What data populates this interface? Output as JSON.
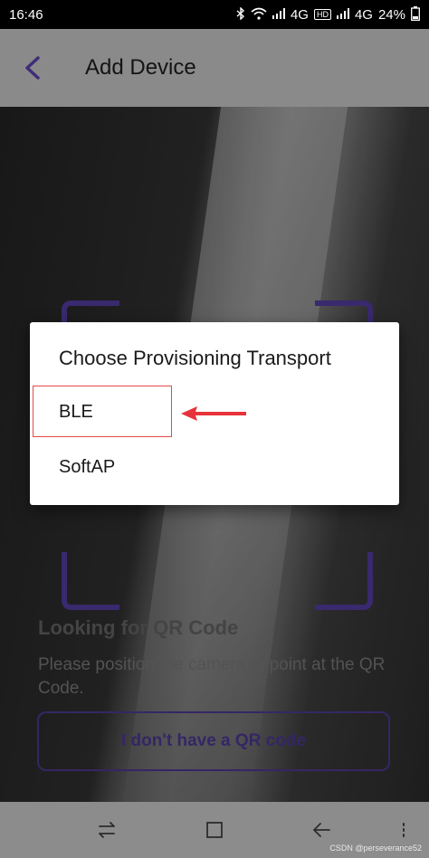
{
  "status_bar": {
    "time": "16:46",
    "network1": "4G",
    "hd": "HD",
    "network2": "4G",
    "battery": "24%",
    "icons": [
      "bluetooth-icon",
      "wifi-icon",
      "signal-icon",
      "signal-icon",
      "battery-icon"
    ]
  },
  "app_bar": {
    "title": "Add Device",
    "back_icon": "chevron-left-icon"
  },
  "scan": {
    "title": "Looking for QR Code",
    "description": "Please position the camera to point at the QR Code.",
    "button_label": "I don't have a QR code"
  },
  "dialog": {
    "title": "Choose Provisioning Transport",
    "options": [
      {
        "label": "BLE"
      },
      {
        "label": "SoftAP"
      }
    ]
  },
  "annotation": {
    "highlight_color": "#e54a4a",
    "arrow_color": "#e8323a"
  },
  "nav_bar": {
    "icons": [
      "switch-icon",
      "home-square-icon",
      "back-arrow-icon",
      "menu-icon"
    ]
  },
  "watermark": "CSDN @perseverance52",
  "colors": {
    "accent": "#3e2d78",
    "dialog_bg": "#ffffff",
    "appbar_bg": "#8a8a8a"
  }
}
